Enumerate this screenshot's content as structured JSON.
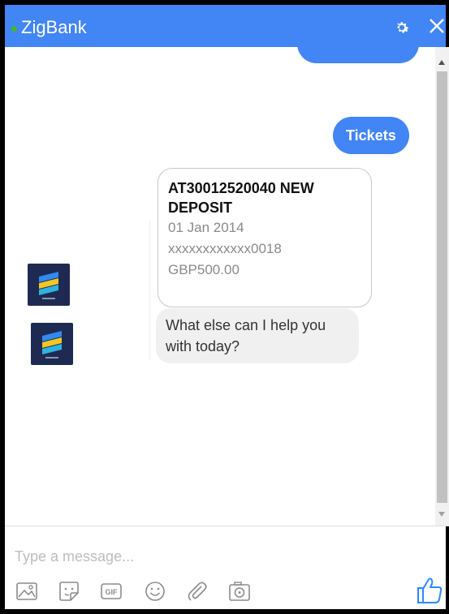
{
  "header": {
    "title": "ZigBank",
    "settings_icon": "gear-icon",
    "close_icon": "close-icon"
  },
  "messages": {
    "user_quick_reply": "Tickets",
    "ticket_card": {
      "title": "AT30012520040 NEW DEPOSIT",
      "date": "01 Jan 2014",
      "account": "xxxxxxxxxxxx0018",
      "amount": "GBP500.00"
    },
    "bot_reply": "What else can I help you with today?"
  },
  "composer": {
    "placeholder": "Type a message..."
  },
  "toolbar": {
    "icons": [
      "image-icon",
      "sticker-icon",
      "gif-icon",
      "emoji-icon",
      "attachment-icon",
      "camera-icon"
    ],
    "gif_label": "GIF",
    "like_icon": "thumbs-up-icon"
  },
  "colors": {
    "accent": "#4285f4",
    "online": "#42b72a",
    "bubble_gray": "#f1f0f0",
    "avatar_bg": "#1f2a52"
  }
}
